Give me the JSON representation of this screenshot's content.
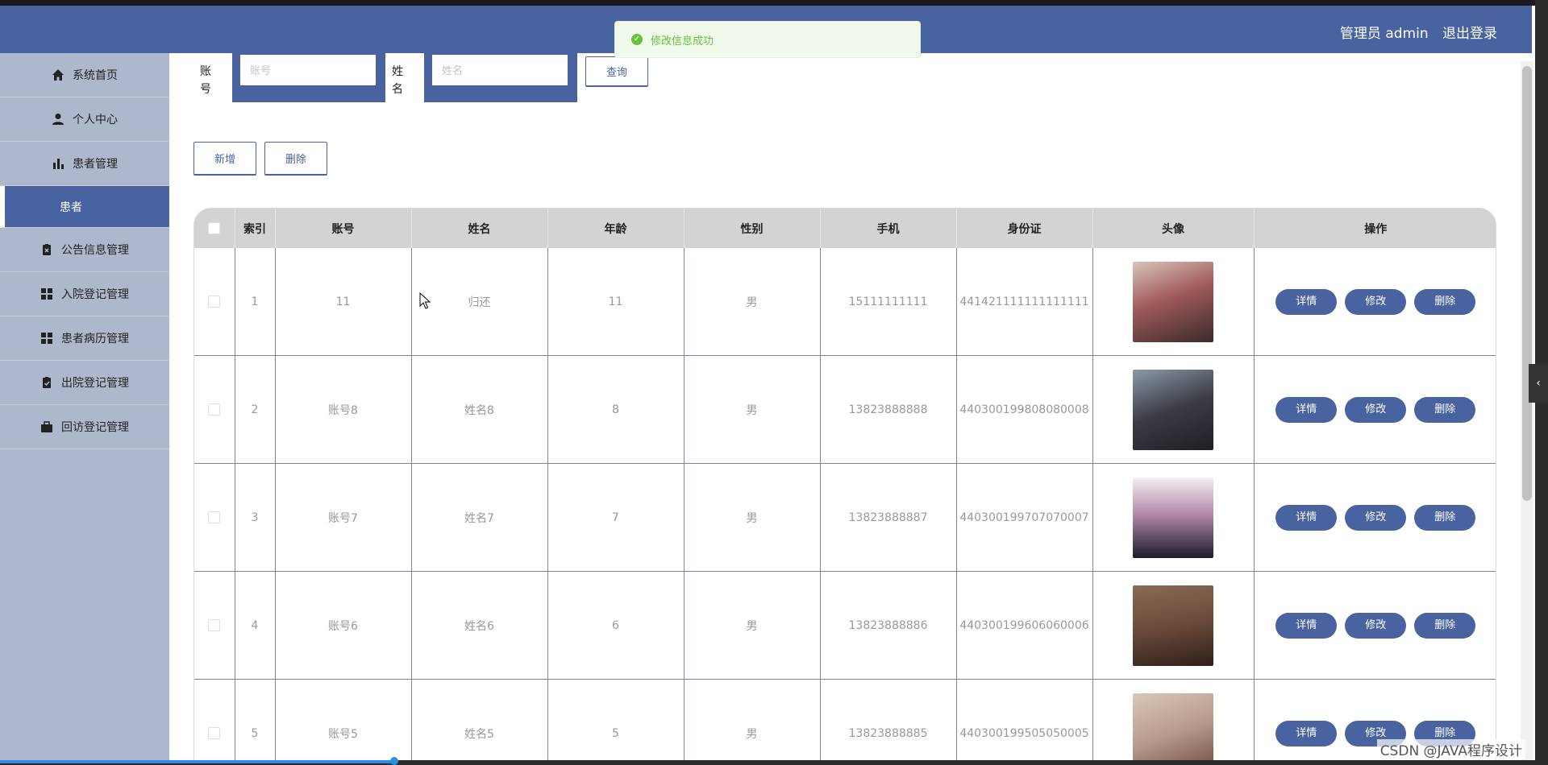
{
  "header": {
    "role": "管理员 admin",
    "logout": "退出登录",
    "color": "#4863a0"
  },
  "toast": {
    "message": "修改信息成功",
    "color": "#67c23a"
  },
  "sidebar": {
    "items": [
      {
        "label": "系统首页",
        "icon": "home-icon"
      },
      {
        "label": "个人中心",
        "icon": "user-icon"
      },
      {
        "label": "患者管理",
        "icon": "bar-chart-icon"
      },
      {
        "label": "患者",
        "icon": "",
        "active": true
      },
      {
        "label": "公告信息管理",
        "icon": "clipboard-icon"
      },
      {
        "label": "入院登记管理",
        "icon": "grid-icon"
      },
      {
        "label": "患者病历管理",
        "icon": "grid-icon"
      },
      {
        "label": "出院登记管理",
        "icon": "clipboard-check-icon"
      },
      {
        "label": "回访登记管理",
        "icon": "briefcase-icon"
      }
    ]
  },
  "search": {
    "account_label": "账号",
    "account_placeholder": "账号",
    "name_label": "姓名",
    "name_placeholder": "姓名",
    "query_button": "查询"
  },
  "actions": {
    "add": "新增",
    "delete": "删除"
  },
  "table": {
    "headers": [
      "索引",
      "账号",
      "姓名",
      "年龄",
      "性别",
      "手机",
      "身份证",
      "头像",
      "操作"
    ],
    "row_actions": {
      "detail": "详情",
      "edit": "修改",
      "delete": "删除"
    },
    "rows": [
      {
        "index": "1",
        "account": "11",
        "name": "归还",
        "age": "11",
        "gender": "男",
        "phone": "15111111111",
        "id_card": "441421111111111111",
        "avatar_color": "#a05a5a"
      },
      {
        "index": "2",
        "account": "账号8",
        "name": "姓名8",
        "age": "8",
        "gender": "男",
        "phone": "13823888888",
        "id_card": "440300199808080008",
        "avatar_color": "#3b3b44"
      },
      {
        "index": "3",
        "account": "账号7",
        "name": "姓名7",
        "age": "7",
        "gender": "男",
        "phone": "13823888887",
        "id_card": "440300199707070007",
        "avatar_color": "#b48aa8"
      },
      {
        "index": "4",
        "account": "账号6",
        "name": "姓名6",
        "age": "6",
        "gender": "男",
        "phone": "13823888886",
        "id_card": "440300199606060006",
        "avatar_color": "#6b4a3a"
      },
      {
        "index": "5",
        "account": "账号5",
        "name": "姓名5",
        "age": "5",
        "gender": "男",
        "phone": "13823888885",
        "id_card": "440300199505050005",
        "avatar_color": "#b89a8a"
      }
    ]
  },
  "watermark": "CSDN @JAVA程序设计"
}
